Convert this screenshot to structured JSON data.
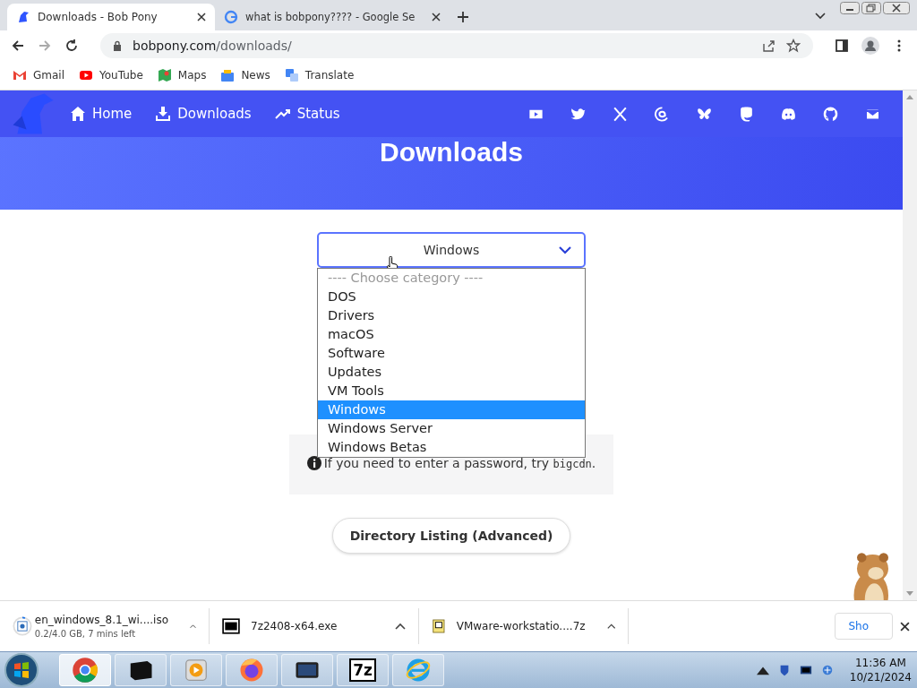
{
  "tabs": [
    {
      "title": "Downloads - Bob Pony",
      "kind": "bobpony",
      "selected": true
    },
    {
      "title": "what is bobpony???? - Google Se",
      "kind": "google",
      "selected": false
    }
  ],
  "address": {
    "domain": "bobpony.com",
    "path": "/downloads/"
  },
  "bookmarks": [
    {
      "label": "Gmail",
      "kind": "gmail"
    },
    {
      "label": "YouTube",
      "kind": "youtube"
    },
    {
      "label": "Maps",
      "kind": "maps"
    },
    {
      "label": "News",
      "kind": "news"
    },
    {
      "label": "Translate",
      "kind": "translate"
    }
  ],
  "site_nav": [
    {
      "label": "Home",
      "kind": "home"
    },
    {
      "label": "Downloads",
      "kind": "download"
    },
    {
      "label": "Status",
      "kind": "status"
    }
  ],
  "social": [
    {
      "kind": "youtube"
    },
    {
      "kind": "twitter"
    },
    {
      "kind": "x"
    },
    {
      "kind": "threads"
    },
    {
      "kind": "bluesky"
    },
    {
      "kind": "mastodon"
    },
    {
      "kind": "discord"
    },
    {
      "kind": "github"
    },
    {
      "kind": "mail"
    }
  ],
  "hero_title": "Downloads",
  "select": {
    "value": "Windows",
    "expanded": true,
    "options": [
      {
        "label": "---- Choose category ----",
        "kind": "placeholder",
        "selected": false
      },
      {
        "label": "DOS",
        "kind": "option",
        "selected": false
      },
      {
        "label": "Drivers",
        "kind": "option",
        "selected": false
      },
      {
        "label": "macOS",
        "kind": "option",
        "selected": false
      },
      {
        "label": "Software",
        "kind": "option",
        "selected": false
      },
      {
        "label": "Updates",
        "kind": "option",
        "selected": false
      },
      {
        "label": "VM Tools",
        "kind": "option",
        "selected": false
      },
      {
        "label": "Windows",
        "kind": "option",
        "selected": true
      },
      {
        "label": "Windows Server",
        "kind": "option",
        "selected": false
      },
      {
        "label": "Windows Betas",
        "kind": "option",
        "selected": false
      }
    ]
  },
  "password_hint": {
    "text": "If you need to enter a password, try ",
    "code": "bigcdn",
    "end": "."
  },
  "directory_button": "Directory Listing (Advanced)",
  "downloads": [
    {
      "name": "en_windows_8.1_wi....iso",
      "status": "0.2/4.0 GB, 7 mins left",
      "kind": "iso",
      "level": 0.05
    },
    {
      "name": "7z2408-x64.exe",
      "kind": "sevenzip"
    },
    {
      "name": "VMware-workstatio....7z",
      "kind": "archive"
    }
  ],
  "show_all": "Sho",
  "taskbar": [
    {
      "kind": "chrome",
      "selected": true
    },
    {
      "kind": "terminal",
      "selected": false
    },
    {
      "kind": "media",
      "selected": false
    },
    {
      "kind": "firefox",
      "selected": false
    },
    {
      "kind": "monitor",
      "selected": false
    },
    {
      "kind": "sevenzip",
      "label": "7z",
      "selected": false
    },
    {
      "kind": "ie",
      "selected": false
    }
  ],
  "clock": {
    "time": "11:36 AM",
    "date": "10/21/2024"
  }
}
